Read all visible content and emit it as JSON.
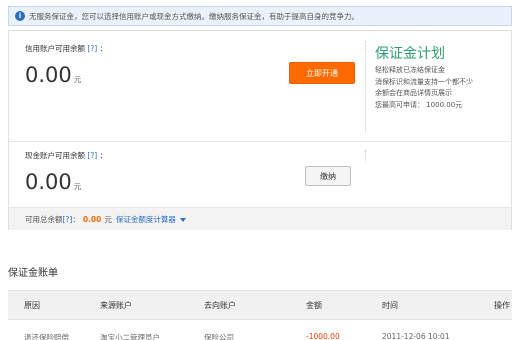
{
  "notice": {
    "icon": "info-icon",
    "text": "无服务保证金，您可以选择信用账户或现金方式缴纳。缴纳服务保证金，有助于提高自身的竞争力。"
  },
  "credit": {
    "label": "信用账户可用余额",
    "help": "[?]",
    "colon": "：",
    "amount": "0.00",
    "unit": "元",
    "button": "立即开通"
  },
  "promo": {
    "title": "保证金计划",
    "lines": [
      "轻松释放已冻结保证金",
      "消保标识和流量支持一个都不少",
      "余额会在商品详情页展示",
      "您最高可申请： 1000.00元"
    ]
  },
  "cash": {
    "label": "现金账户可用余额",
    "help": "[?]",
    "colon": "：",
    "amount": "0.00",
    "unit": "元",
    "button": "缴纳"
  },
  "footer": {
    "label": "可用总余额",
    "help": "[?]",
    "colon": "：",
    "amount": "0.00",
    "unit": "元",
    "calculator": "保证金额度计算器"
  },
  "bill": {
    "title": "保证金账单",
    "columns": [
      "原因",
      "来源账户",
      "去向账户",
      "金额",
      "时间",
      "操作"
    ],
    "row": [
      "退还保险赔偿",
      "淘宝小二管理员户",
      "保险公司",
      "-1000.00",
      "2011-12-06 10:01",
      ""
    ]
  },
  "colors": {
    "accent": "#ff6a00",
    "link": "#2a6fc2",
    "promo": "#2e9e6e"
  }
}
